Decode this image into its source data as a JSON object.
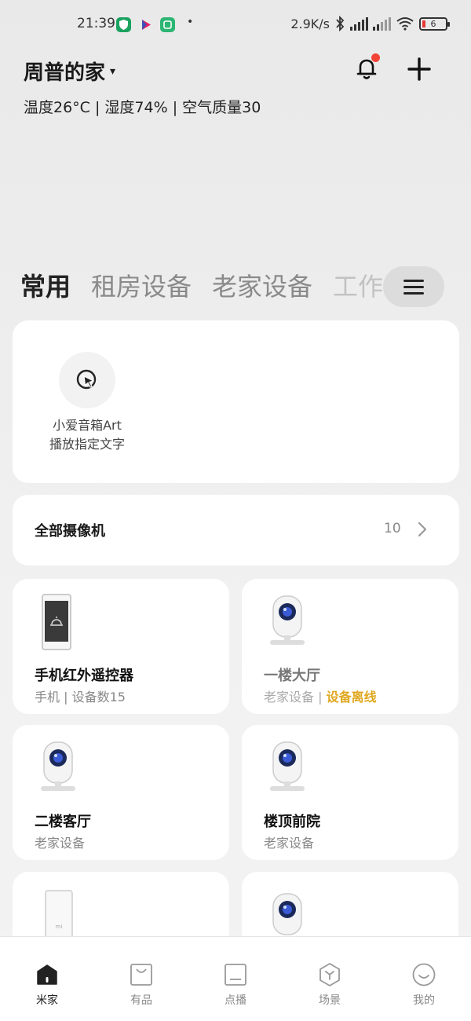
{
  "status_bar": {
    "time": "21:39",
    "dot": "•",
    "net_speed": "2.9K/s",
    "battery": "6",
    "app_icons": [
      {
        "name": "shield-app-icon",
        "color": "#1aa260"
      },
      {
        "name": "play-app-icon",
        "color": "#e91e63"
      },
      {
        "name": "mijia-app-icon",
        "color": "#2bb673"
      }
    ]
  },
  "header": {
    "home_name": "周普的家",
    "caret": "▾",
    "environment": "温度26°C | 湿度74% | 空气质量30",
    "notification_badge_color": "#f44336"
  },
  "tabs": {
    "items": [
      {
        "label": "常用",
        "state": "active"
      },
      {
        "label": "租房设备",
        "state": "normal"
      },
      {
        "label": "老家设备",
        "state": "normal"
      },
      {
        "label": "工作",
        "state": "fade"
      }
    ]
  },
  "shortcut": {
    "line1": "小爱音箱Art",
    "line2": "播放指定文字"
  },
  "cameras": {
    "title": "全部摄像机",
    "count": "10"
  },
  "devices": [
    {
      "name": "手机红外遥控器",
      "sub": "手机 | 设备数15",
      "icon": "phone-remote-icon",
      "offline": false
    },
    {
      "name": "一楼大厅",
      "sub": "老家设备 | ",
      "offline_label": "设备离线",
      "icon": "camera-icon",
      "offline": true
    },
    {
      "name": "二楼客厅",
      "sub": "老家设备",
      "icon": "camera-icon",
      "offline": false
    },
    {
      "name": "楼顶前院",
      "sub": "老家设备",
      "icon": "camera-icon",
      "offline": false
    },
    {
      "name": "",
      "sub": "",
      "icon": "router-icon",
      "offline": false
    },
    {
      "name": "",
      "sub": "",
      "icon": "camera-icon",
      "offline": false
    }
  ],
  "bottom_nav": [
    {
      "label": "米家",
      "icon": "home-icon",
      "active": true
    },
    {
      "label": "有品",
      "icon": "shop-bag-icon",
      "active": false
    },
    {
      "label": "点播",
      "icon": "tv-icon",
      "active": false
    },
    {
      "label": "场景",
      "icon": "hexagon-scene-icon",
      "active": false
    },
    {
      "label": "我的",
      "icon": "smile-profile-icon",
      "active": false
    }
  ]
}
